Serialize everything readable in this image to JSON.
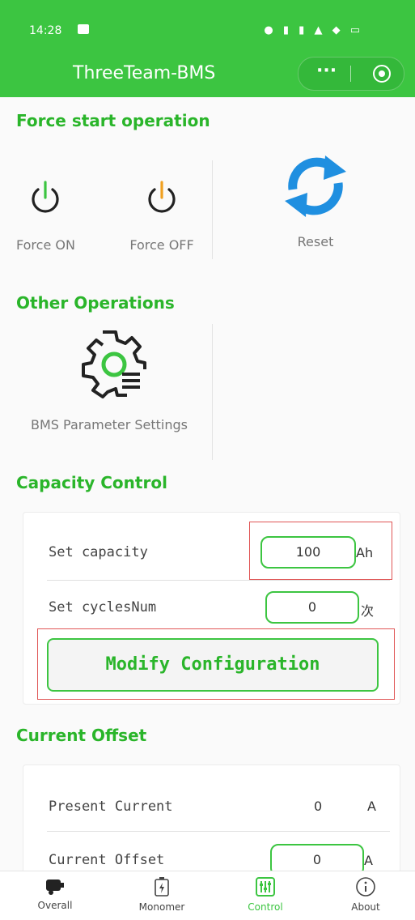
{
  "status_bar": {
    "time": "14:28"
  },
  "header": {
    "title": "ThreeTeam-BMS",
    "more_icon": "ellipsis-icon",
    "target_icon": "target-icon"
  },
  "force_section": {
    "title": "Force start operation",
    "force_on_label": "Force ON",
    "force_off_label": "Force OFF",
    "reset_label": "Reset"
  },
  "other_section": {
    "title": "Other Operations",
    "bms_label": "BMS Parameter Settings"
  },
  "capacity_section": {
    "title": "Capacity Control",
    "set_capacity_label": "Set capacity",
    "set_capacity_value": "100",
    "set_capacity_unit": "Ah",
    "set_cycles_label": "Set cyclesNum",
    "set_cycles_value": "0",
    "set_cycles_unit": "次",
    "modify_label": "Modify Configuration"
  },
  "offset_section": {
    "title": "Current Offset",
    "present_current_label": "Present Current",
    "present_current_value": "0",
    "present_current_unit": "A",
    "current_offset_label": "Current Offset",
    "current_offset_value": "0",
    "current_offset_unit": "A"
  },
  "tabs": [
    {
      "label": "Overall",
      "icon": "battery-car-icon"
    },
    {
      "label": "Monomer",
      "icon": "battery-icon"
    },
    {
      "label": "Control",
      "icon": "sliders-icon",
      "active": true
    },
    {
      "label": "About",
      "icon": "info-icon"
    }
  ],
  "colors": {
    "accent": "#3cc541",
    "reset_blue": "#1f8fe0",
    "power_green": "#3cc541",
    "power_orange": "#f0a020"
  }
}
